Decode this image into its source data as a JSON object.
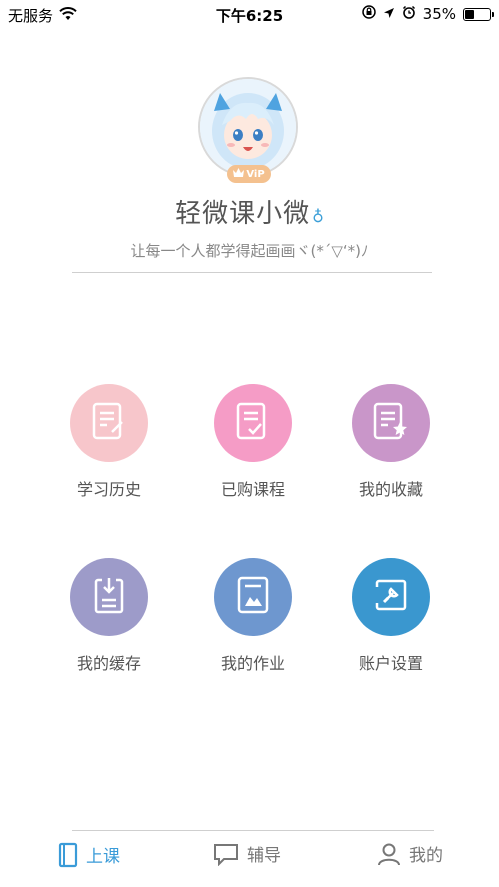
{
  "status_bar": {
    "carrier": "无服务",
    "time": "下午6:25",
    "battery_percent": "35%",
    "battery_level": 0.35
  },
  "profile": {
    "vip_label": "ViP",
    "username": "轻微课小微",
    "gender_symbol": "♁",
    "signature": "让每一个人都学得起画画ヾ(*´▽‘*)ﾉ"
  },
  "menu": [
    {
      "label": "学习历史",
      "color": "#f7c6cb",
      "icon": "study-history-icon"
    },
    {
      "label": "已购课程",
      "color": "#f59cc6",
      "icon": "purchased-courses-icon"
    },
    {
      "label": "我的收藏",
      "color": "#c996c9",
      "icon": "favorites-icon"
    },
    {
      "label": "我的缓存",
      "color": "#9d9bc9",
      "icon": "cache-icon"
    },
    {
      "label": "我的作业",
      "color": "#6e97cf",
      "icon": "homework-icon"
    },
    {
      "label": "账户设置",
      "color": "#3a97cf",
      "icon": "account-settings-icon"
    }
  ],
  "tabbar": {
    "tabs": [
      {
        "label": "上课",
        "active": true
      },
      {
        "label": "辅导",
        "active": false
      },
      {
        "label": "我的",
        "active": false
      }
    ],
    "active_color": "#3a9bd8",
    "inactive_color": "#777777"
  }
}
